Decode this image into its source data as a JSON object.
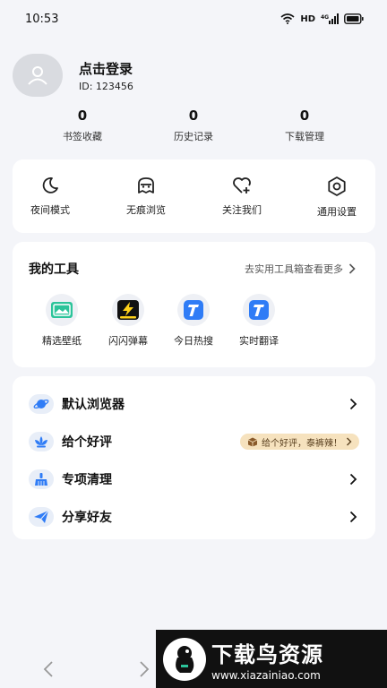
{
  "status_bar": {
    "time": "10:53",
    "network": "HD",
    "signal": "4G"
  },
  "profile": {
    "login_text": "点击登录",
    "user_id": "ID: 123456"
  },
  "stats": [
    {
      "value": "0",
      "label": "书签收藏"
    },
    {
      "value": "0",
      "label": "历史记录"
    },
    {
      "value": "0",
      "label": "下载管理"
    }
  ],
  "quick_actions": [
    {
      "label": "夜间模式",
      "icon": "moon-icon"
    },
    {
      "label": "无痕浏览",
      "icon": "incognito-icon"
    },
    {
      "label": "关注我们",
      "icon": "heart-plus-icon"
    },
    {
      "label": "通用设置",
      "icon": "settings-icon"
    }
  ],
  "tools": {
    "title": "我的工具",
    "more_link": "去实用工具箱查看更多",
    "items": [
      {
        "label": "精选壁纸",
        "icon": "wallpaper-icon"
      },
      {
        "label": "闪闪弹幕",
        "icon": "lightning-icon"
      },
      {
        "label": "今日热搜",
        "icon": "hot-search-icon"
      },
      {
        "label": "实时翻译",
        "icon": "translate-icon"
      }
    ]
  },
  "menu": [
    {
      "label": "默认浏览器",
      "icon": "planet-icon"
    },
    {
      "label": "给个好评",
      "icon": "lotus-icon",
      "badge": "给个好评，泰裤辣！"
    },
    {
      "label": "专项清理",
      "icon": "broom-icon"
    },
    {
      "label": "分享好友",
      "icon": "paper-plane-icon"
    }
  ],
  "watermark": {
    "title": "下载鸟资源",
    "url": "www.xiazainiao.com"
  },
  "colors": {
    "accent": "#2f7cf6",
    "background": "#f4f5f9",
    "badge_bg": "#f6e2be"
  }
}
